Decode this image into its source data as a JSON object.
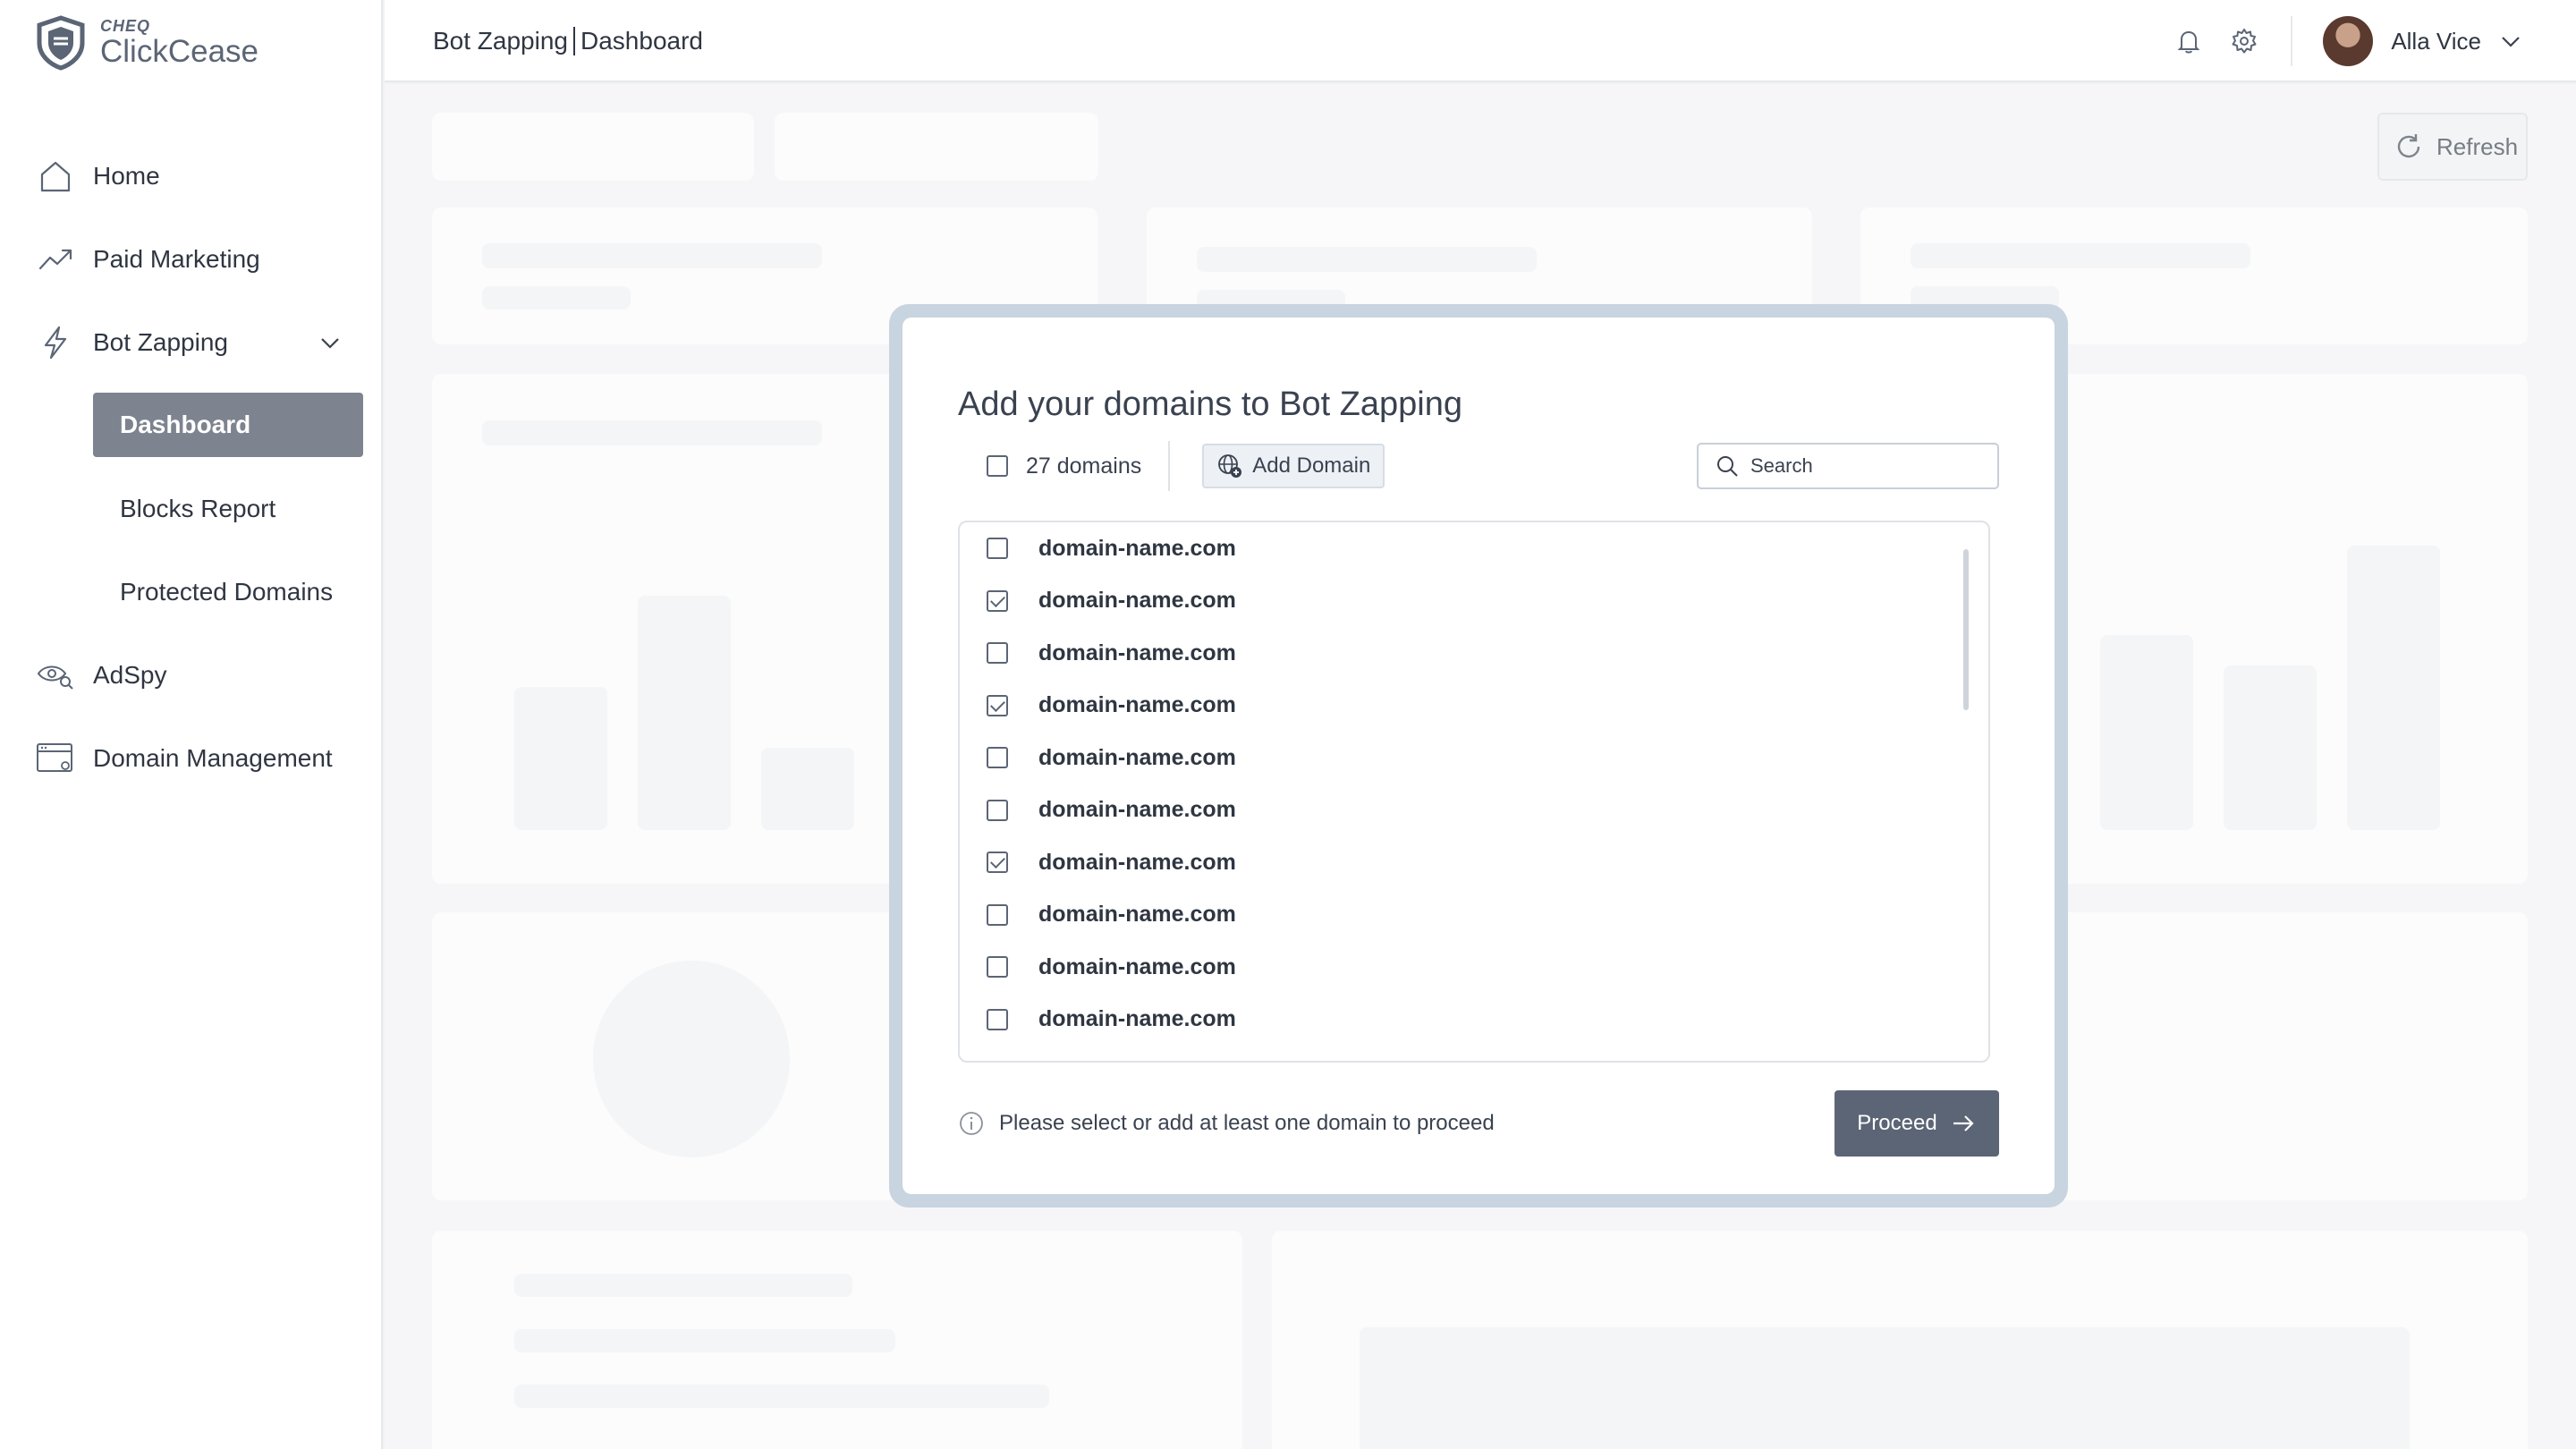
{
  "app": {
    "brand_small": "CHEQ",
    "brand_name": "ClickCease"
  },
  "sidebar": {
    "items": [
      {
        "label": "Home",
        "icon": "home-icon"
      },
      {
        "label": "Paid Marketing",
        "icon": "trend-up-icon"
      },
      {
        "label": "Bot Zapping",
        "icon": "lightning-icon"
      },
      {
        "label": "AdSpy",
        "icon": "eye-search-icon"
      },
      {
        "label": "Domain Management",
        "icon": "browser-window-icon"
      }
    ],
    "sub_items": [
      "Dashboard",
      "Blocks Report",
      "Protected Domains"
    ]
  },
  "header": {
    "crumb_section": "Bot Zapping",
    "crumb_page": "Dashboard",
    "user_name": "Alla Vice"
  },
  "toolbar": {
    "refresh_label": "Refresh"
  },
  "modal": {
    "title": "Add your domains to Bot Zapping",
    "domain_count": "27 domains",
    "add_domain_label": "Add Domain",
    "search_placeholder": "Search",
    "domains": [
      {
        "name": "domain-name.com",
        "checked": false
      },
      {
        "name": "domain-name.com",
        "checked": true
      },
      {
        "name": "domain-name.com",
        "checked": false
      },
      {
        "name": "domain-name.com",
        "checked": true
      },
      {
        "name": "domain-name.com",
        "checked": false
      },
      {
        "name": "domain-name.com",
        "checked": false
      },
      {
        "name": "domain-name.com",
        "checked": true
      },
      {
        "name": "domain-name.com",
        "checked": false
      },
      {
        "name": "domain-name.com",
        "checked": false
      },
      {
        "name": "domain-name.com",
        "checked": false
      }
    ],
    "note": "Please select or add at least one domain to proceed",
    "proceed_label": "Proceed"
  },
  "colors": {
    "accent": "#5b6575",
    "active_nav": "#7d838f",
    "modal_frame": "#c8d4df"
  }
}
